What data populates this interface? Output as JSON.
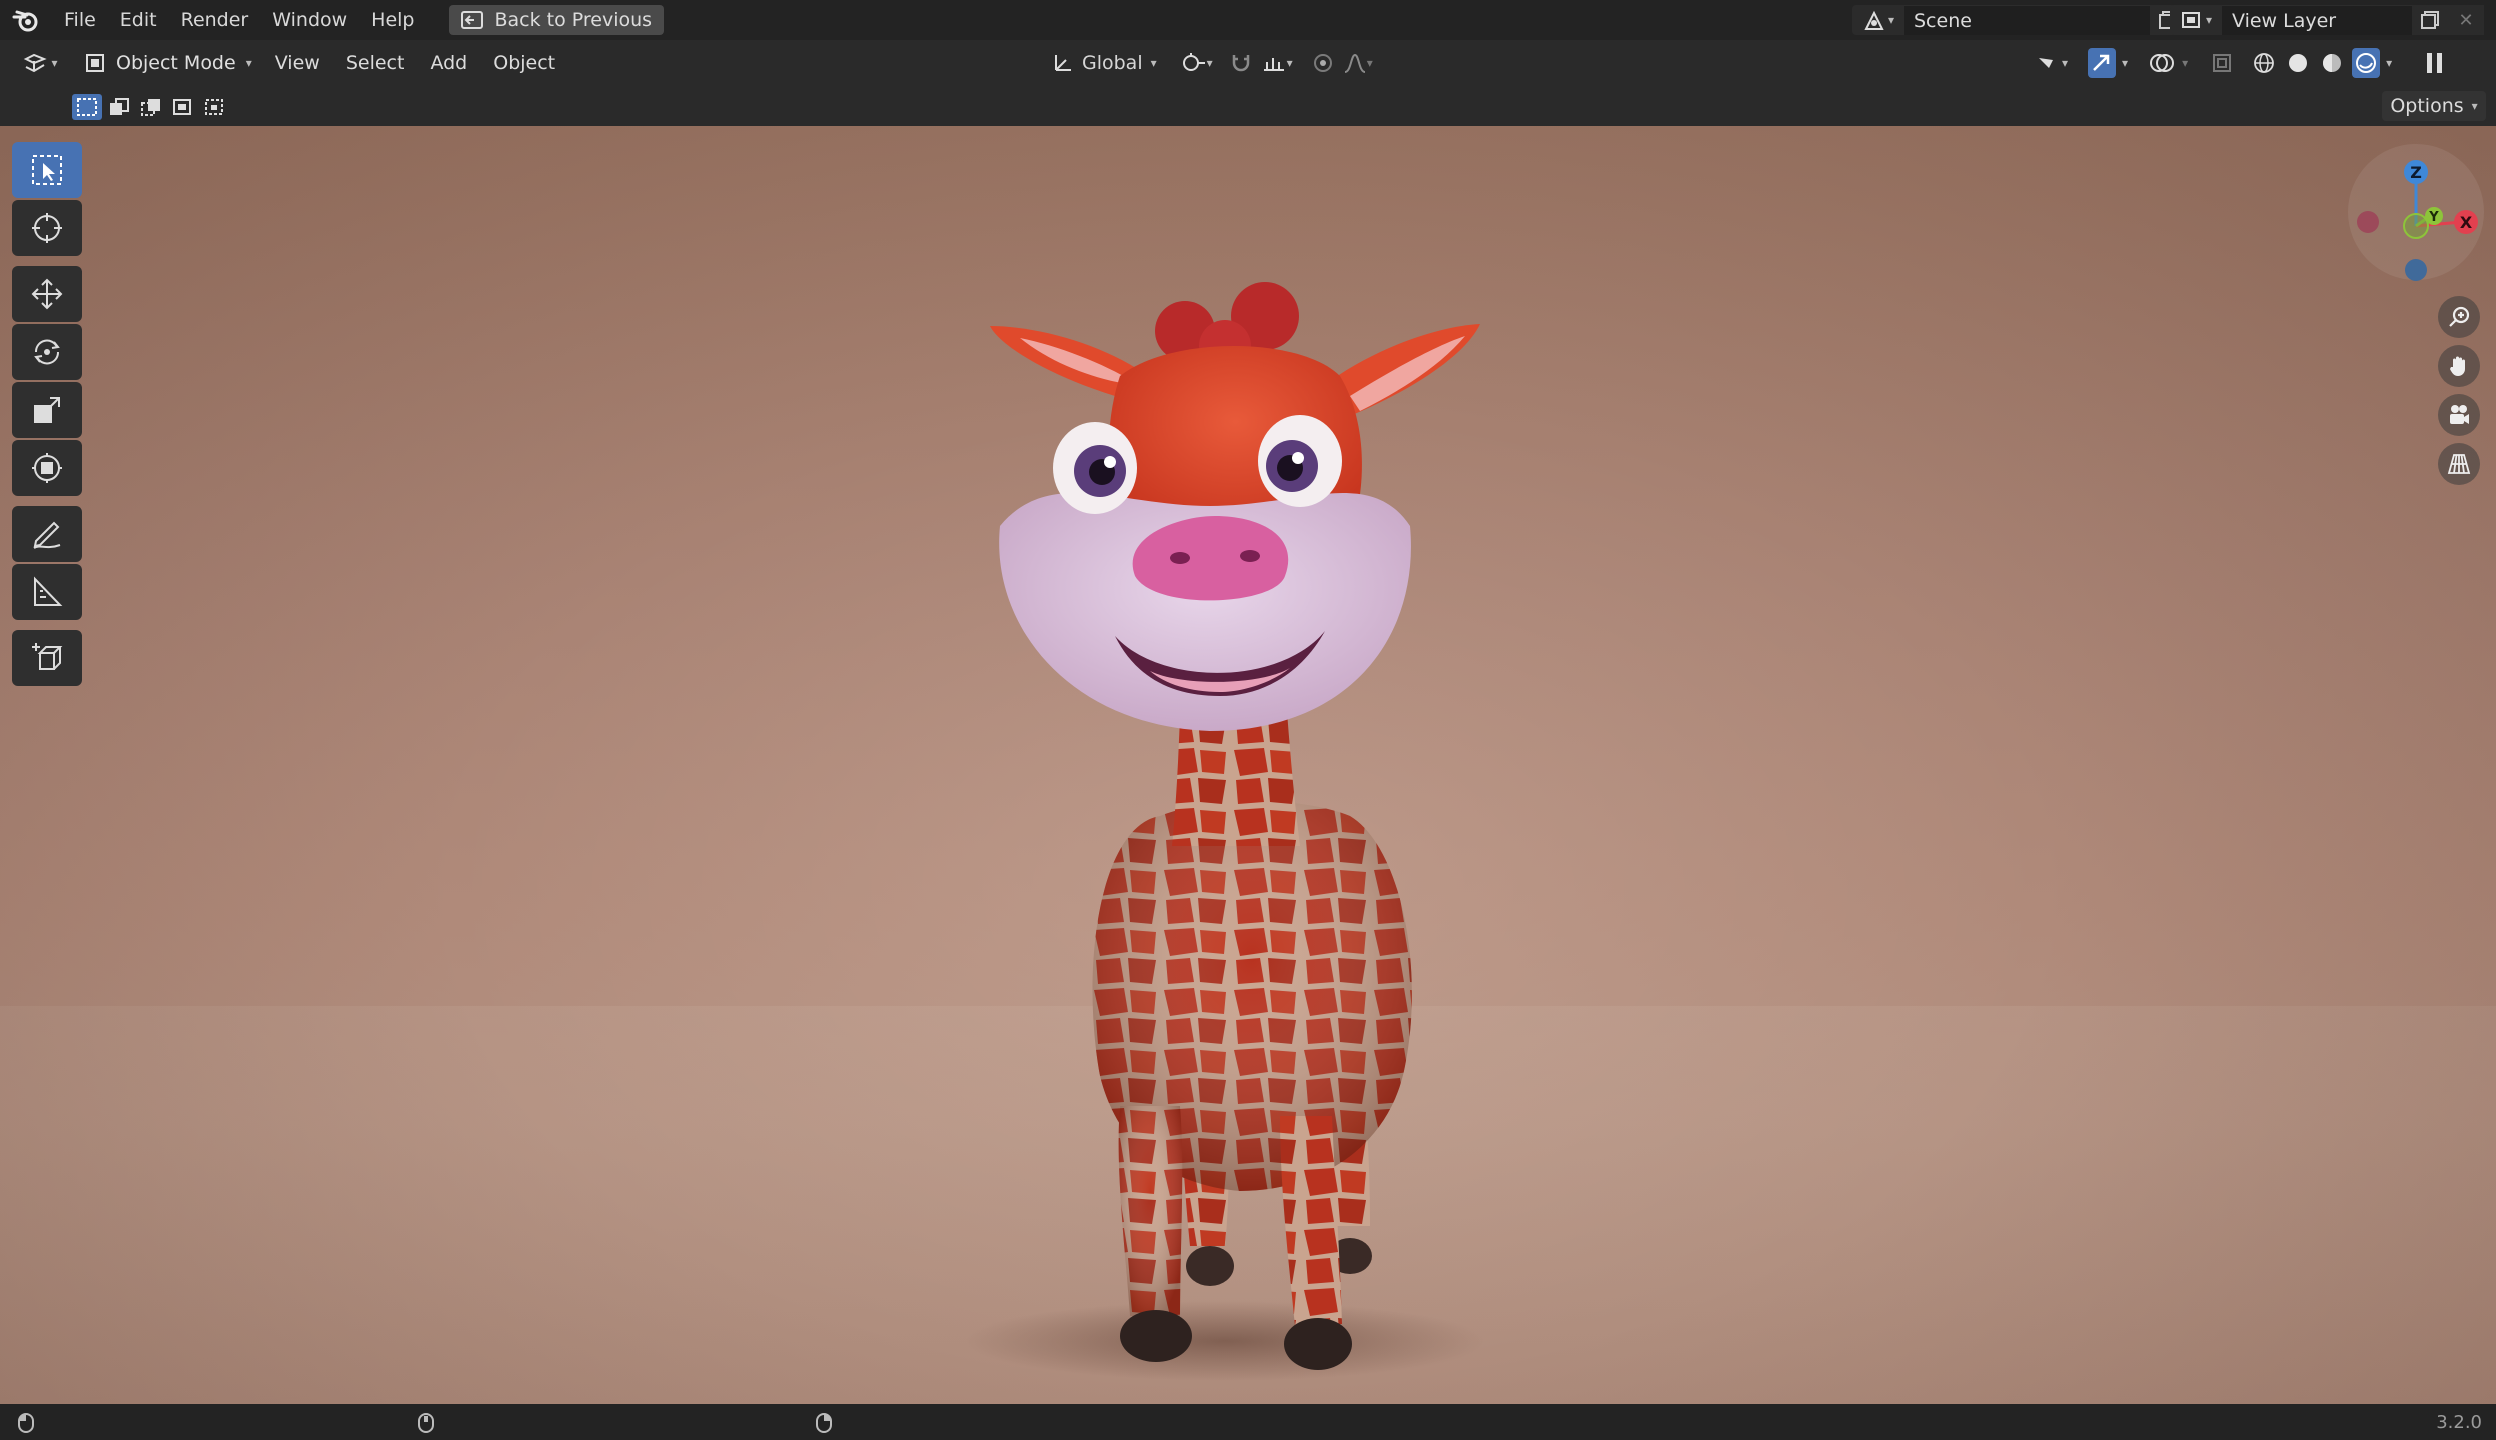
{
  "menubar": {
    "items": [
      "File",
      "Edit",
      "Render",
      "Window",
      "Help"
    ],
    "back_button": "Back to Previous",
    "scene_label": "Scene",
    "view_layer_label": "View Layer"
  },
  "header": {
    "mode": "Object Mode",
    "menus": [
      "View",
      "Select",
      "Add",
      "Object"
    ],
    "orientation": "Global"
  },
  "toolheader": {
    "options_label": "Options"
  },
  "gizmo": {
    "z_label": "Z",
    "x_label": "X",
    "y_label": "Y"
  },
  "status": {
    "version": "3.2.0"
  },
  "colors": {
    "accent": "#4772b3",
    "axis_x": "#e2404f",
    "axis_y": "#8dc43a",
    "axis_z": "#3f88d8"
  }
}
